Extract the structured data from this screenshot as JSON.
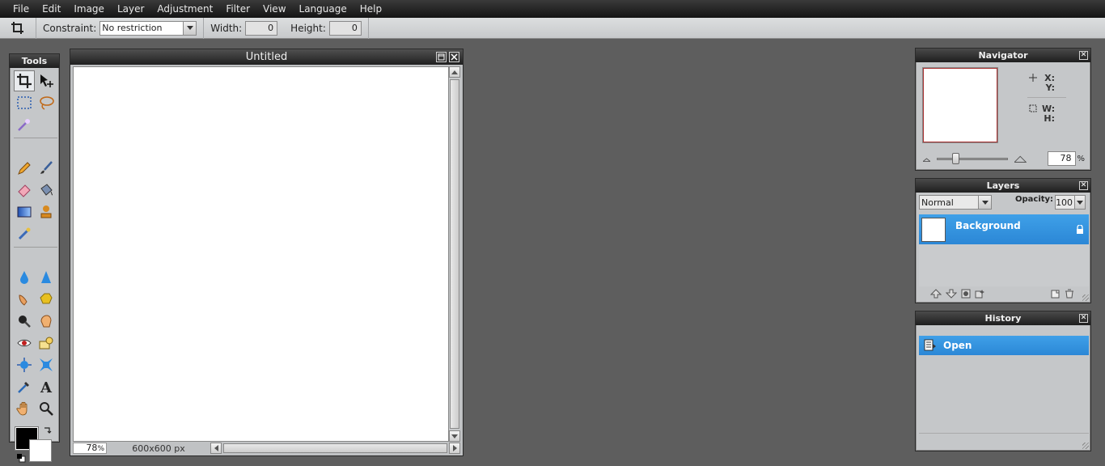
{
  "menu": {
    "items": [
      "File",
      "Edit",
      "Image",
      "Layer",
      "Adjustment",
      "Filter",
      "View",
      "Language",
      "Help"
    ]
  },
  "options": {
    "constraint_label": "Constraint:",
    "constraint_value": "No restriction",
    "width_label": "Width:",
    "width_value": "0",
    "height_label": "Height:",
    "height_value": "0"
  },
  "tools": {
    "title": "Tools",
    "items": [
      "crop-tool",
      "move-tool",
      "marquee-tool",
      "lasso-tool",
      "magic-wand-tool",
      "pencil-tool",
      "brush-tool",
      "eraser-tool",
      "bucket-fill-tool",
      "gradient-tool",
      "clone-stamp-tool",
      "color-replace-tool",
      "blur-tool",
      "sharpen-tool",
      "smudge-tool",
      "sponge-tool",
      "dodge-tool",
      "burn-tool",
      "red-eye-tool",
      "spot-heal-tool",
      "bloat-tool",
      "pinch-tool",
      "color-picker-tool",
      "type-tool",
      "hand-tool",
      "zoom-tool"
    ],
    "foreground_color": "#000000",
    "background_color": "#ffffff"
  },
  "document": {
    "title": "Untitled",
    "zoom": "78",
    "zoom_unit": "%",
    "dimensions": "600x600 px"
  },
  "navigator": {
    "title": "Navigator",
    "x_label": "X:",
    "y_label": "Y:",
    "w_label": "W:",
    "h_label": "H:",
    "zoom_value": "78",
    "zoom_unit": "%"
  },
  "layers": {
    "title": "Layers",
    "blend_mode": "Normal",
    "opacity_label": "Opacity:",
    "opacity_value": "100",
    "items": [
      {
        "name": "Background",
        "locked": true
      }
    ]
  },
  "history": {
    "title": "History",
    "items": [
      "Open"
    ]
  },
  "colors": {
    "selection_blue": "#2b87d6",
    "workspace": "#5e5e5e",
    "panel": "#c5c7c9"
  }
}
